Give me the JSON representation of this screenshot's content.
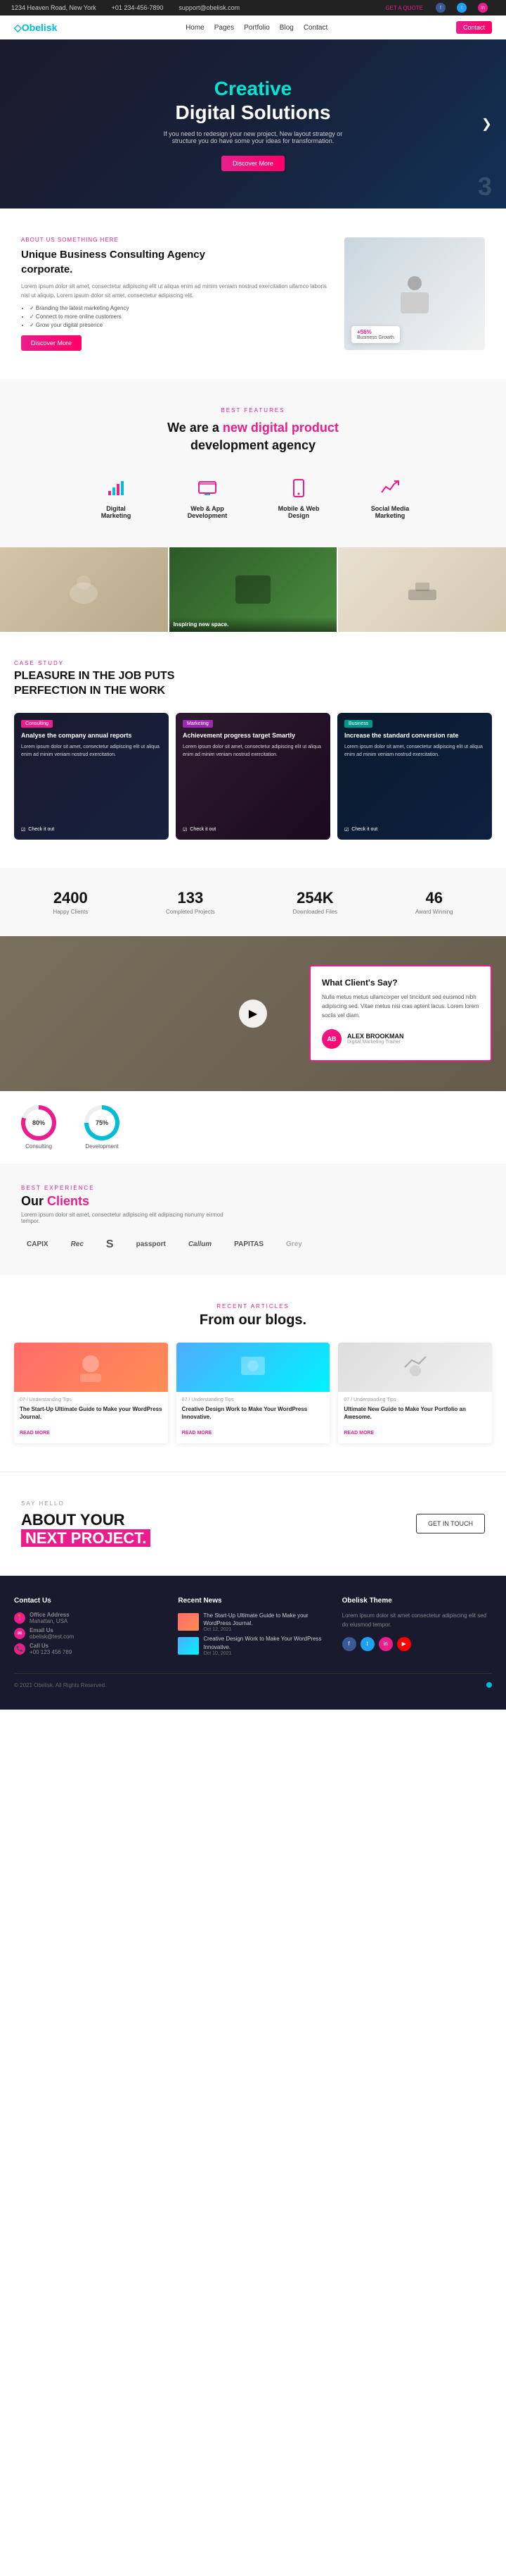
{
  "topbar": {
    "address": "1234 Heaven Road, New York",
    "phone": "+01 234-456-7890",
    "email": "support@obelisk.com",
    "cta": "GET A QUOTE",
    "social": [
      "f",
      "t",
      "in"
    ]
  },
  "navbar": {
    "logo": "Obelisk",
    "nav_items": [
      "Home",
      "Pages",
      "Portfolio",
      "Blog",
      "Contact"
    ],
    "button": "Contact"
  },
  "hero": {
    "line1": "Creative",
    "line2": "Digital Solutions",
    "description": "If you need to redesign your new project, New layout strategy or structure you do have some your ideas for transformation.",
    "button": "Discover More",
    "slide_num": "3"
  },
  "about": {
    "label": "ABOUT US SOMETHING HERE",
    "heading1": "Unique Business Consulting Agency",
    "heading2": "corporate.",
    "description": "Lorem ipsum dolor sit amet, consectetur adipiscing elit ut aliqua enim ad minim veniam nostrud exercitation ullamco laboris nisl ut aliquip. Lorem ipsum dolor sit amet, consectetur adipiscing elit.",
    "list_items": [
      "Branding the latest marketing Agency",
      "Connect to more online customers",
      "Grow your digital presence"
    ],
    "button": "Discover More",
    "card_text": "Business Growth",
    "card_value": "+56%"
  },
  "features": {
    "label": "BEST FEATURES",
    "heading": "We are a new digital product development agency",
    "heading_highlight": "new digital product",
    "items": [
      {
        "icon": "chart-icon",
        "label": "Digital Marketing"
      },
      {
        "icon": "monitor-icon",
        "label": "Web & App Development"
      },
      {
        "icon": "mobile-icon",
        "label": "Mobile & Web Design"
      },
      {
        "icon": "trend-icon",
        "label": "Social Media Marketing"
      }
    ]
  },
  "gallery": {
    "items": [
      {
        "caption": ""
      },
      {
        "caption": "Inspiring new space."
      },
      {
        "caption": ""
      }
    ]
  },
  "case_study": {
    "label": "CASE STUDY",
    "heading1": "PLEASURE IN THE JOB PUTS",
    "heading2": "PERFECTION IN THE WORK",
    "cards": [
      {
        "tag": "Consulting",
        "title": "Analyse the company annual reports",
        "desc": "Lorem ipsum dolor sit amet, consectetur adipiscing elit ut aliqua enim ad minim veniam nostrud exercitation.",
        "tag_color": "pink",
        "btn_label": "Check it out"
      },
      {
        "tag": "Marketing",
        "title": "Achievement progress target Smartly",
        "desc": "Lorem ipsum dolor sit amet, consectetur adipiscing elit ut aliqua enim ad minim veniam nostrud exercitation.",
        "tag_color": "purple",
        "btn_label": "Check it out"
      },
      {
        "tag": "Business",
        "title": "Increase the standard conversion rate",
        "desc": "Lorem ipsum dolor sit amet, consectetur adipiscing elit ut aliqua enim ad minim veniam nostrud exercitation.",
        "tag_color": "teal",
        "btn_label": "Check it out"
      }
    ]
  },
  "stats": {
    "items": [
      {
        "num": "2400",
        "desc": "Happy Clients"
      },
      {
        "num": "133",
        "desc": "Completed Projects"
      },
      {
        "num": "254K",
        "desc": "Downloaded Files"
      },
      {
        "num": "46",
        "desc": "Award Winning"
      }
    ]
  },
  "testimonial": {
    "heading": "What Client's Say?",
    "text": "Nulla metus metus ullamcorper vel tincidunt sed euismod nibh adipiscing sed. Vitae metus nisi cras aptent lacus. Lorem lorem sociis vel diam.",
    "reviewer_name": "ALEX BROOKMAN",
    "reviewer_role": "Digital Marketing Trainer",
    "play_label": "▶"
  },
  "skills": {
    "items": [
      {
        "label": "Consulting",
        "percent": "80%",
        "value": 80,
        "color": "#e91e8c"
      },
      {
        "label": "Development",
        "percent": "75%",
        "value": 75,
        "color": "#00bcd4"
      }
    ]
  },
  "clients": {
    "label": "BEST EXPERIENCE",
    "heading": "Our Clients",
    "description": "Lorem ipsum dolor sit amet, consectetur adipiscing elit adipiscing nonumy eirmod tempor.",
    "logos": [
      "CAPIX",
      "Rec",
      "S",
      "passport",
      "Callum",
      "PAPITAS",
      "Grey"
    ]
  },
  "blog": {
    "label": "RECENT ARTICLES",
    "heading": "From our blogs.",
    "cards": [
      {
        "date": "07 / Understanding Tips",
        "title": "The Start-Up Ultimate Guide to Make your WordPress Journal.",
        "read_more": "READ MORE"
      },
      {
        "date": "07 / Understanding Tips",
        "title": "Creative Design Work to Make Your WordPress Innovative.",
        "read_more": "READ MORE"
      },
      {
        "date": "07 / Understanding Tips",
        "title": "Ultimate New Guide to Make Your Portfolio an Awesome.",
        "read_more": "READ MORE"
      }
    ]
  },
  "cta": {
    "label": "SAY HELLO",
    "heading1": "ABOUT YOUR",
    "heading2": "NEXT PROJECT.",
    "button": "GET IN TOUCH"
  },
  "footer": {
    "contact_heading": "Contact Us",
    "address": "Office Address",
    "address_val": "Mahattan, USA",
    "email_label": "Email Us",
    "email_val": "obelisk@test.com",
    "call_label": "Call Us",
    "call_val": "+00 123 456 789",
    "news_heading": "Recent News",
    "news_items": [
      {
        "title": "The Start-Up Ultimate Guide to Make your WordPress Journal.",
        "date": "Oct 12, 2021"
      },
      {
        "title": "Creative Design Work to Make Your WordPress Innovative.",
        "date": "Oct 10, 2021"
      }
    ],
    "theme_heading": "Obelisk Theme",
    "theme_desc": "Lorem ipsum dolor sit amet consectetur adipiscing elit sed do eiusmod tempor.",
    "copyright": "© 2021 Obelisk. All Rights Reserved.",
    "social": [
      "f",
      "t",
      "in",
      "yt"
    ]
  }
}
